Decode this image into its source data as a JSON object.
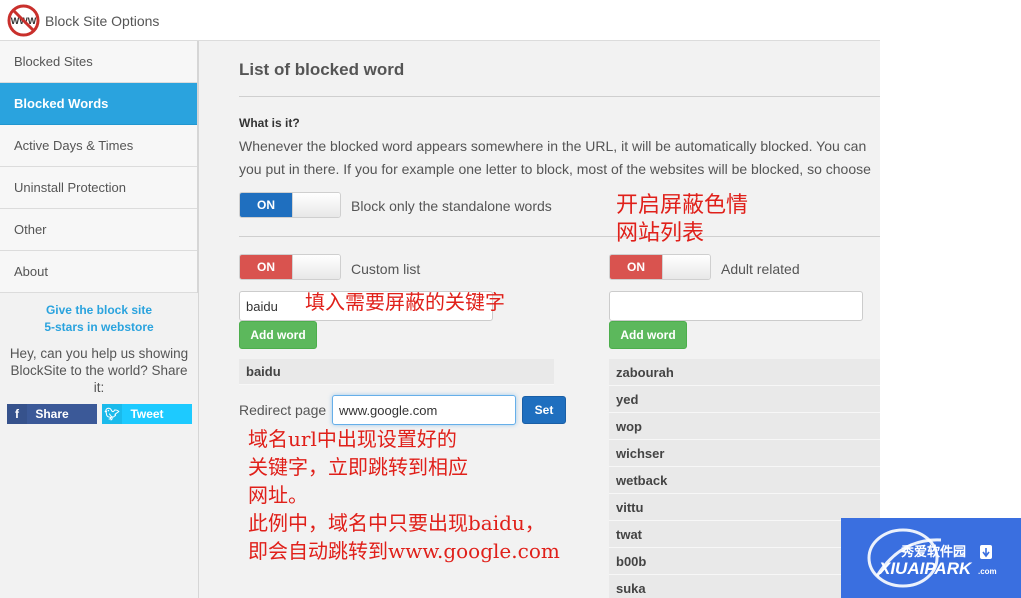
{
  "app": {
    "title": "Block Site Options",
    "logo_text": "WWW"
  },
  "sidebar": {
    "items": [
      {
        "label": "Blocked Sites",
        "active": false
      },
      {
        "label": "Blocked Words",
        "active": true
      },
      {
        "label": "Active Days & Times",
        "active": false
      },
      {
        "label": "Uninstall Protection",
        "active": false
      },
      {
        "label": "Other",
        "active": false
      },
      {
        "label": "About",
        "active": false
      }
    ],
    "promo_line1": "Give the block site",
    "promo_line2": "5-stars in webstore",
    "share_text": "Hey, can you help us showing BlockSite to the world? Share it:",
    "share_button": "Share",
    "tweet_button": "Tweet"
  },
  "main": {
    "title": "List of blocked word",
    "what_heading": "What is it?",
    "desc_line1": "Whenever the blocked word appears somewhere in the URL, it will be automatically blocked. You can",
    "desc_line2": "you put in there. If you for example one letter to block, most of the websites will be blocked, so choose",
    "standalone_toggle": {
      "state": "ON",
      "label": "Block only the standalone words"
    },
    "custom": {
      "toggle_state": "ON",
      "label": "Custom list",
      "input_value": "baidu",
      "add_button": "Add word",
      "words": [
        "baidu"
      ]
    },
    "adult": {
      "toggle_state": "ON",
      "label": "Adult related",
      "input_value": "",
      "add_button": "Add word",
      "words": [
        "zabourah",
        "yed",
        "wop",
        "wichser",
        "wetback",
        "vittu",
        "twat",
        "b00b",
        "suka"
      ]
    },
    "redirect": {
      "label": "Redirect page",
      "input_value": "www.google.com",
      "set_button": "Set"
    }
  },
  "annotations": {
    "adult_note_line1": "开启屏蔽色情",
    "adult_note_line2": "网站列表",
    "keyword_note": "填入需要屏蔽的关键字",
    "redirect_note_line1": "域名url中出现设置好的",
    "redirect_note_line2": "关键字，立即跳转到相应",
    "redirect_note_line3": "网址。",
    "redirect_note_line4": "此例中，域名中只要出现baidu，",
    "redirect_note_line5": "即会自动跳转到www.google.com"
  },
  "watermark": {
    "cn_text": "秀爱软件园",
    "en_text": "XIUAIPARK",
    "suffix": ".com"
  },
  "colors": {
    "accent": "#2aa3de",
    "toggle_blue": "#1f6fbf",
    "toggle_red": "#d9534f",
    "button_green": "#5cb85c",
    "annotation_red": "#e0201a",
    "facebook": "#3b5998",
    "twitter": "#1dcaff"
  }
}
